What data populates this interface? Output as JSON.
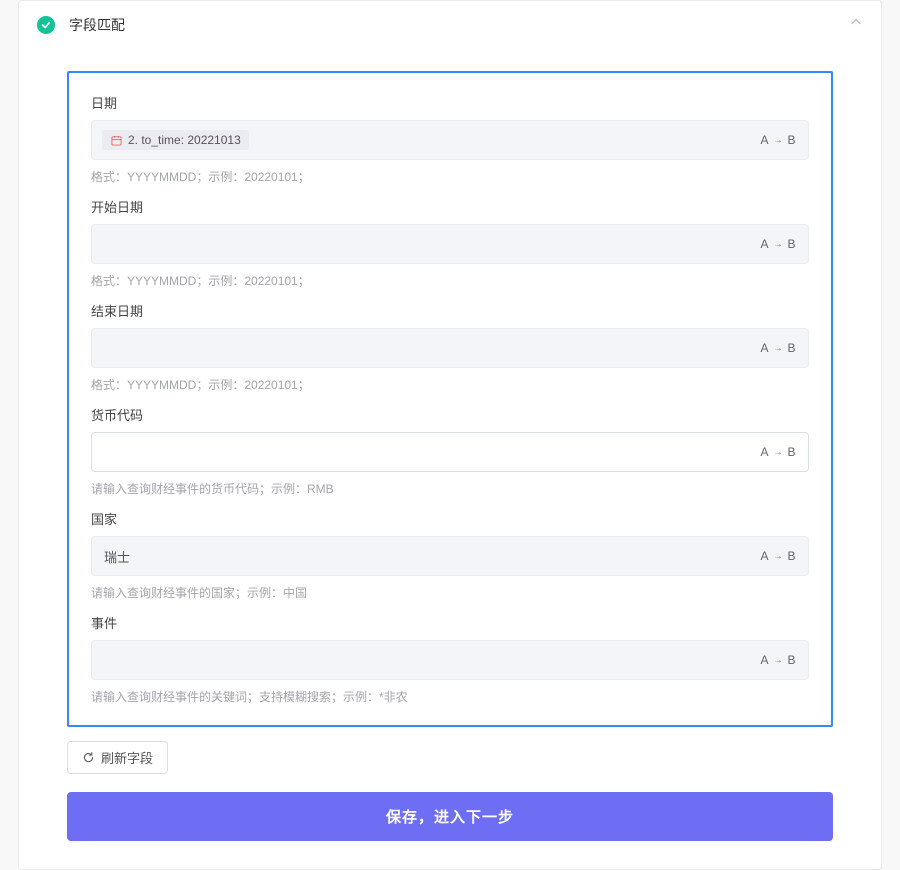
{
  "panel": {
    "title": "字段匹配",
    "ab_a": "A",
    "ab_b": "B"
  },
  "fields": {
    "f1": {
      "label": "日期",
      "token_text": "2. to_time: 20221013",
      "helper": "格式：YYYYMMDD；示例：20220101；"
    },
    "f2": {
      "label": "开始日期",
      "helper": "格式：YYYYMMDD；示例：20220101；"
    },
    "f3": {
      "label": "结束日期",
      "helper": "格式：YYYYMMDD；示例：20220101；"
    },
    "f4": {
      "label": "货币代码",
      "helper": "请输入查询财经事件的货币代码；示例：RMB"
    },
    "f5": {
      "label": "国家",
      "value": "瑞士",
      "helper": "请输入查询财经事件的国家；示例：中国"
    },
    "f6": {
      "label": "事件",
      "helper": "请输入查询财经事件的关键词；支持模糊搜索；示例：*非农"
    }
  },
  "buttons": {
    "refresh": "刷新字段",
    "save": "保存，进入下一步"
  }
}
